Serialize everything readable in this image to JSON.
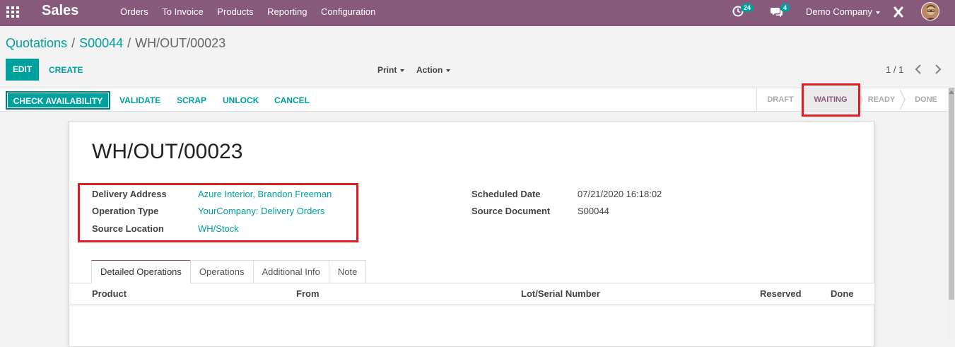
{
  "topnav": {
    "brand": "Sales",
    "menu": [
      "Orders",
      "To Invoice",
      "Products",
      "Reporting",
      "Configuration"
    ],
    "activity_count": "24",
    "message_count": "4",
    "company": "Demo Company",
    "bg_color": "#875a7b"
  },
  "breadcrumb": {
    "items": [
      "Quotations",
      "S00044"
    ],
    "current": "WH/OUT/00023",
    "separator": "/"
  },
  "controls": {
    "edit_label": "EDIT",
    "create_label": "CREATE",
    "print_label": "Print",
    "action_label": "Action",
    "pager": "1 / 1"
  },
  "statusbar": {
    "buttons": [
      "CHECK AVAILABILITY",
      "VALIDATE",
      "SCRAP",
      "UNLOCK",
      "CANCEL"
    ],
    "steps": [
      "DRAFT",
      "WAITING",
      "READY",
      "DONE"
    ],
    "active_step": "WAITING"
  },
  "record": {
    "title": "WH/OUT/00023",
    "left_fields": [
      {
        "label": "Delivery Address",
        "value": "Azure Interior, Brandon Freeman"
      },
      {
        "label": "Operation Type",
        "value": "YourCompany: Delivery Orders"
      },
      {
        "label": "Source Location",
        "value": "WH/Stock"
      }
    ],
    "right_fields": [
      {
        "label": "Scheduled Date",
        "value": "07/21/2020 16:18:02"
      },
      {
        "label": "Source Document",
        "value": "S00044"
      }
    ]
  },
  "tabs": [
    "Detailed Operations",
    "Operations",
    "Additional Info",
    "Note"
  ],
  "active_tab": "Detailed Operations",
  "table": {
    "columns": [
      "Product",
      "From",
      "Lot/Serial Number",
      "Reserved",
      "Done"
    ]
  },
  "colors": {
    "accent": "#00a09d",
    "brand": "#875a7b",
    "highlight": "#dc1f26"
  }
}
